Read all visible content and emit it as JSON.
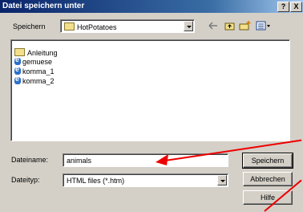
{
  "window": {
    "title": "Datei speichern unter",
    "help_btn": "?",
    "close_btn": "X"
  },
  "location": {
    "label": "Speichern",
    "value": "HotPotatoes"
  },
  "files": [
    {
      "name": "Anleitung",
      "type": "folder"
    },
    {
      "name": "gemuese",
      "type": "file"
    },
    {
      "name": "komma_1",
      "type": "file"
    },
    {
      "name": "komma_2",
      "type": "file"
    }
  ],
  "filename": {
    "label": "Dateiname:",
    "value": "animals"
  },
  "filetype": {
    "label": "Dateityp:",
    "value": "HTML files (*.htm)"
  },
  "buttons": {
    "save": "Speichern",
    "cancel": "Abbrechen",
    "help": "Hilfe"
  },
  "icons": [
    "folder-icon",
    "back-icon",
    "up-folder-icon",
    "new-folder-icon",
    "view-menu-icon",
    "ie-file-icon"
  ],
  "colors": {
    "title_start": "#0a246a",
    "title_end": "#a6caf0",
    "annotation": "#e00000"
  }
}
